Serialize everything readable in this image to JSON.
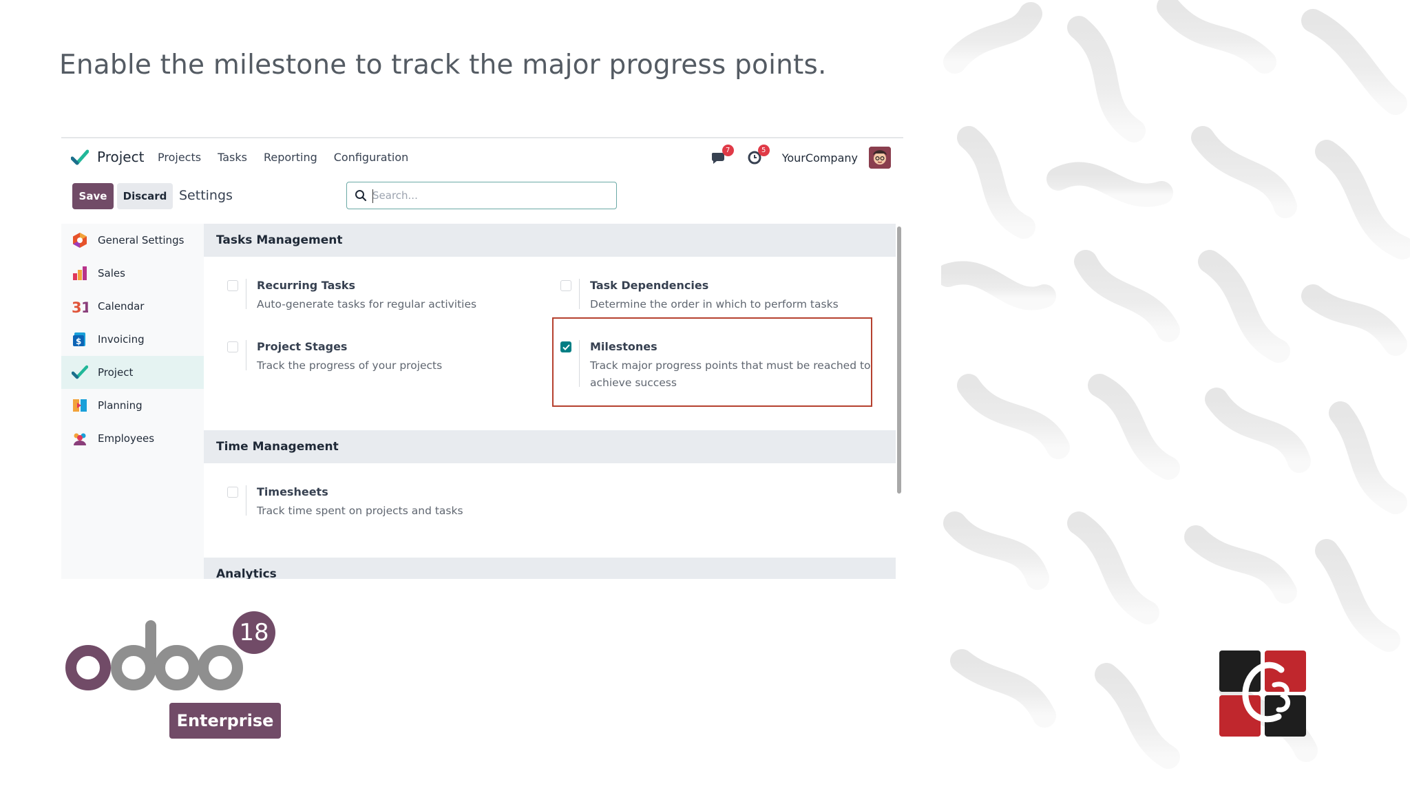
{
  "caption": "Enable the milestone to track the major progress points.",
  "navbar": {
    "app_name": "Project",
    "menu": [
      "Projects",
      "Tasks",
      "Reporting",
      "Configuration"
    ],
    "messages_count": "7",
    "activities_count": "5",
    "company": "YourCompany"
  },
  "control": {
    "save_label": "Save",
    "discard_label": "Discard",
    "breadcrumb": "Settings",
    "search_placeholder": "Search..."
  },
  "sidebar": {
    "items": [
      {
        "label": "General Settings",
        "icon": "general-settings-icon"
      },
      {
        "label": "Sales",
        "icon": "sales-icon"
      },
      {
        "label": "Calendar",
        "icon": "calendar-icon"
      },
      {
        "label": "Invoicing",
        "icon": "invoicing-icon"
      },
      {
        "label": "Project",
        "icon": "project-icon",
        "active": true
      },
      {
        "label": "Planning",
        "icon": "planning-icon"
      },
      {
        "label": "Employees",
        "icon": "employees-icon"
      }
    ]
  },
  "sections": {
    "tasks": {
      "title": "Tasks Management",
      "recurring": {
        "title": "Recurring Tasks",
        "desc": "Auto-generate tasks for regular activities",
        "checked": false
      },
      "dependencies": {
        "title": "Task Dependencies",
        "desc": "Determine the order in which to perform tasks",
        "checked": false
      },
      "stages": {
        "title": "Project Stages",
        "desc": "Track the progress of your projects",
        "checked": false
      },
      "milestones": {
        "title": "Milestones",
        "desc_line1": "Track major progress points that must be reached to",
        "desc_line2": "achieve success",
        "checked": true
      }
    },
    "time": {
      "title": "Time Management",
      "timesheets": {
        "title": "Timesheets",
        "desc": "Track time spent on projects and tasks",
        "checked": false
      }
    },
    "analytics": {
      "title": "Analytics"
    }
  },
  "brand": {
    "logo_text": "odoo",
    "version": "18",
    "edition": "Enterprise"
  },
  "colors": {
    "primary": "#714b67",
    "checkbox": "#017e84",
    "highlight": "#b5402e"
  }
}
